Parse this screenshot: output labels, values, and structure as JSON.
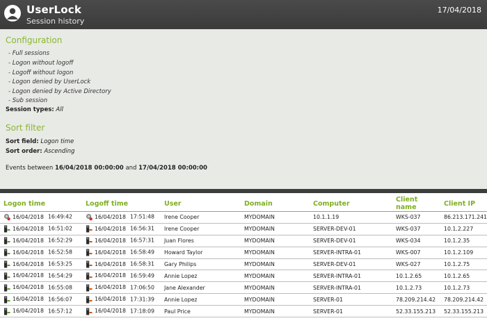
{
  "header": {
    "app_title": "UserLock",
    "subtitle": "Session history",
    "date": "17/04/2018"
  },
  "config": {
    "title": "Configuration",
    "items": [
      "- Full sessions",
      "- Logon without logoff",
      "- Logoff without logon",
      "- Logon denied by UserLock",
      "- Logon denied by Active Directory",
      "- Sub session"
    ],
    "session_types_label": "Session types:",
    "session_types_value": "All"
  },
  "sort": {
    "title": "Sort filter",
    "field_label": "Sort field:",
    "field_value": "Logon time",
    "order_label": "Sort order:",
    "order_value": "Ascending"
  },
  "events": {
    "prefix": "Events between",
    "start": "16/04/2018 00:00:00",
    "and": "and",
    "end": "17/04/2018 00:00:00"
  },
  "table": {
    "headers": [
      "Logon time",
      "Logoff time",
      "User",
      "Domain",
      "Computer",
      "Client name",
      "Client IP"
    ],
    "rows": [
      {
        "logon_icon": "session-icon",
        "logon_date": "16/04/2018",
        "logon_time": "16:49:42",
        "logoff_icon": "session-icon",
        "logoff_date": "16/04/2018",
        "logoff_time": "17:51:48",
        "user": "Irene Cooper",
        "domain": "MYDOMAIN",
        "computer": "10.1.1.19",
        "client_name": "WKS-037",
        "client_ip": "86.213.171.241"
      },
      {
        "logon_icon": "logon-icon",
        "logon_date": "16/04/2018",
        "logon_time": "16:51:02",
        "logoff_icon": "logoff-icon",
        "logoff_date": "16/04/2018",
        "logoff_time": "16:56:31",
        "user": "Irene Cooper",
        "domain": "MYDOMAIN",
        "computer": "SERVER-DEV-01",
        "client_name": "WKS-037",
        "client_ip": "10.1.2.227"
      },
      {
        "logon_icon": "logon-icon",
        "logon_date": "16/04/2018",
        "logon_time": "16:52:29",
        "logoff_icon": "logoff-icon",
        "logoff_date": "16/04/2018",
        "logoff_time": "16:57:31",
        "user": "Juan Flores",
        "domain": "MYDOMAIN",
        "computer": "SERVER-DEV-01",
        "client_name": "WKS-034",
        "client_ip": "10.1.2.35"
      },
      {
        "logon_icon": "logon-icon",
        "logon_date": "16/04/2018",
        "logon_time": "16:52:58",
        "logoff_icon": "logoff-icon",
        "logoff_date": "16/04/2018",
        "logoff_time": "16:58:49",
        "user": "Howard Taylor",
        "domain": "MYDOMAIN",
        "computer": "SERVER-INTRA-01",
        "client_name": "WKS-007",
        "client_ip": "10.1.2.109"
      },
      {
        "logon_icon": "logon-icon",
        "logon_date": "16/04/2018",
        "logon_time": "16:53:25",
        "logoff_icon": "logoff-icon",
        "logoff_date": "16/04/2018",
        "logoff_time": "16:58:31",
        "user": "Gary Philips",
        "domain": "MYDOMAIN",
        "computer": "SERVER-DEV-01",
        "client_name": "WKS-027",
        "client_ip": "10.1.2.75"
      },
      {
        "logon_icon": "logon-icon",
        "logon_date": "16/04/2018",
        "logon_time": "16:54:29",
        "logoff_icon": "logoff-icon",
        "logoff_date": "16/04/2018",
        "logoff_time": "16:59:49",
        "user": "Annie Lopez",
        "domain": "MYDOMAIN",
        "computer": "SERVER-INTRA-01",
        "client_name": "10.1.2.65",
        "client_ip": "10.1.2.65"
      },
      {
        "logon_icon": "logon-icon",
        "logon_date": "16/04/2018",
        "logon_time": "16:55:08",
        "logoff_icon": "logoff-icon",
        "logoff_date": "16/04/2018",
        "logoff_time": "17:06:50",
        "user": "Jane Alexander",
        "domain": "MYDOMAIN",
        "computer": "SERVER-INTRA-01",
        "client_name": "10.1.2.73",
        "client_ip": "10.1.2.73"
      },
      {
        "logon_icon": "logon-icon",
        "logon_date": "16/04/2018",
        "logon_time": "16:56:07",
        "logoff_icon": "logoff-icon",
        "logoff_date": "16/04/2018",
        "logoff_time": "17:31:39",
        "user": "Annie Lopez",
        "domain": "MYDOMAIN",
        "computer": "SERVER-01",
        "client_name": "78.209.214.42",
        "client_ip": "78.209.214.42"
      },
      {
        "logon_icon": "logon-icon",
        "logon_date": "16/04/2018",
        "logon_time": "16:57:12",
        "logoff_icon": "logoff-icon",
        "logoff_date": "16/04/2018",
        "logoff_time": "17:18:09",
        "user": "Paul Price",
        "domain": "MYDOMAIN",
        "computer": "SERVER-01",
        "client_name": "52.33.155.213",
        "client_ip": "52.33.155.213"
      }
    ]
  },
  "colors": {
    "accent_green": "#8bb630",
    "header_bg": "#3f3f3f",
    "panel_bg": "#e8eae6"
  }
}
